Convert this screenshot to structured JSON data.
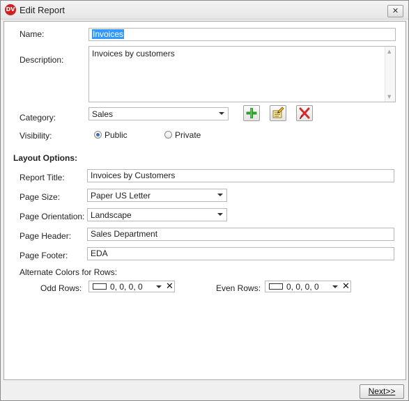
{
  "window": {
    "title": "Edit Report",
    "close_glyph": "✕",
    "app_icon": "DV"
  },
  "form": {
    "name_label": "Name:",
    "name_value": "Invoices",
    "description_label": "Description:",
    "description_value": "Invoices by customers",
    "category_label": "Category:",
    "category_value": "Sales",
    "visibility_label": "Visibility:",
    "visibility_options": [
      "Public",
      "Private"
    ],
    "visibility_selected": "Public"
  },
  "layout": {
    "section_title": "Layout Options:",
    "report_title_label": "Report Title:",
    "report_title_value": "Invoices by Customers",
    "page_size_label": "Page Size:",
    "page_size_value": "Paper US Letter",
    "page_orientation_label": "Page Orientation:",
    "page_orientation_value": "Landscape",
    "page_header_label": "Page Header:",
    "page_header_value": "Sales Department",
    "page_footer_label": "Page Footer:",
    "page_footer_value": "EDA",
    "alt_colors_label": "Alternate Colors for Rows:",
    "odd_rows_label": "Odd Rows:",
    "odd_rows_value": "0, 0, 0, 0",
    "even_rows_label": "Even Rows:",
    "even_rows_value": "0, 0, 0, 0"
  },
  "icons": {
    "add": "add-icon",
    "edit": "edit-icon",
    "delete": "delete-icon",
    "clear": "clear-icon"
  },
  "footer": {
    "next_label": "Next>>"
  },
  "colors": {
    "selection": "#3399ff",
    "add_green": "#2e9e2e",
    "delete_red": "#d42a2a",
    "edit_yellow": "#e8b820"
  }
}
